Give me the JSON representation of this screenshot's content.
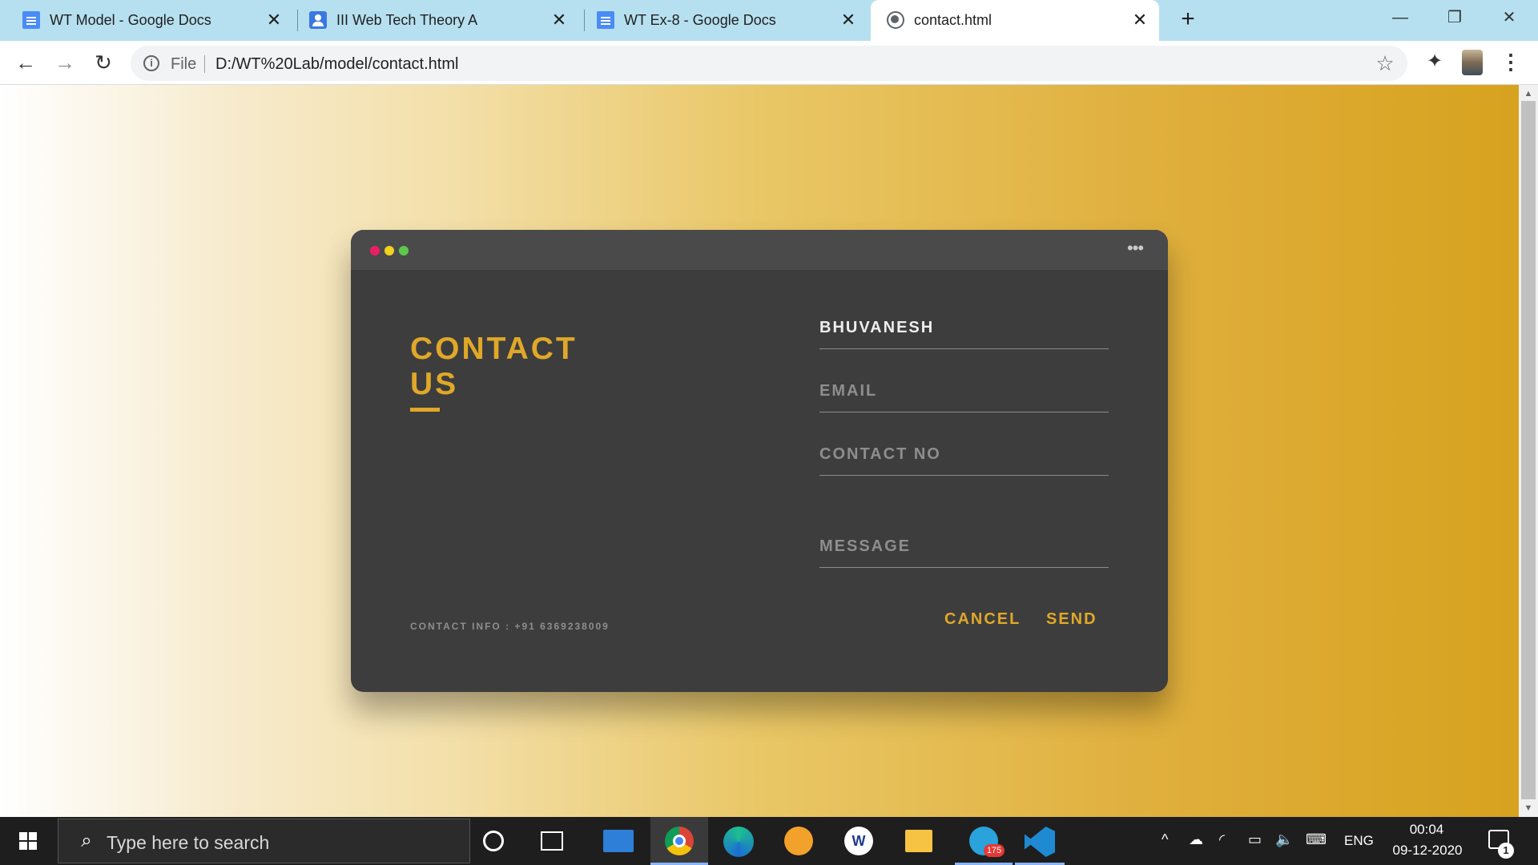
{
  "browser": {
    "tabs": [
      {
        "title": "WT Model - Google Docs",
        "icon": "google-docs-icon"
      },
      {
        "title": "III Web Tech Theory A",
        "icon": "google-classroom-icon"
      },
      {
        "title": "WT Ex-8 - Google Docs",
        "icon": "google-docs-icon"
      },
      {
        "title": "contact.html",
        "icon": "globe-icon",
        "active": true
      }
    ],
    "new_tab": "+",
    "window_controls": {
      "minimize": "—",
      "restore": "❐",
      "close": "✕"
    },
    "nav": {
      "back": "←",
      "forward": "→",
      "reload": "↻"
    },
    "omnibox": {
      "scheme_label": "File",
      "url": "D:/WT%20Lab/model/contact.html",
      "info": "i",
      "bookmark": "☆"
    },
    "toolbar_icons": {
      "extensions": "✦",
      "menu": "⋮"
    }
  },
  "contact_form": {
    "window_dots": {
      "colors": [
        "#ed1f62",
        "#f0d21f",
        "#5ec84a"
      ]
    },
    "more": "•••",
    "title_line1": "CONTACT",
    "title_line2": "US",
    "contact_info": "CONTACT INFO : +91 6369238009",
    "fields": {
      "name": {
        "value": "BHUVANESH"
      },
      "email": {
        "placeholder": "EMAIL"
      },
      "contact_no": {
        "placeholder": "CONTACT NO"
      },
      "message": {
        "placeholder": "MESSAGE"
      }
    },
    "cancel_label": "CANCEL",
    "send_label": "SEND",
    "accent": "#e0a828"
  },
  "taskbar": {
    "search_placeholder": "Type here to search",
    "telegram_badge": "175",
    "tray": {
      "language": "ENG",
      "time": "00:04",
      "date": "09-12-2020",
      "notifications": "1"
    }
  },
  "colors": {
    "tab_bar": "#b6e0f0",
    "card": "#3d3d3e",
    "card_header": "#4a4a4b",
    "gradient_end": "#d7a21e"
  }
}
